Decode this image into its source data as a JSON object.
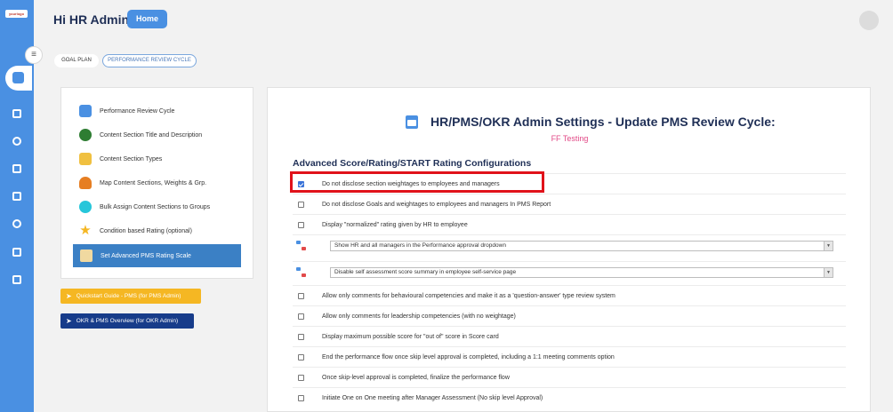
{
  "rail": {
    "logo_text": "yourlogo"
  },
  "header": {
    "greeting": "Hi HR Admin",
    "home_label": "Home"
  },
  "tabs": [
    {
      "label": "GOAL PLAN"
    },
    {
      "label": "PERFORMANCE REVIEW CYCLE"
    }
  ],
  "menu": {
    "items": [
      {
        "label": "Performance Review Cycle",
        "icon": "calendar-icon",
        "color": "#4a90e2"
      },
      {
        "label": "Content Section Title and Description",
        "icon": "dots-icon",
        "color": "#2e7d32"
      },
      {
        "label": "Content Section Types",
        "icon": "badge-icon",
        "color": "#f0c040"
      },
      {
        "label": "Map Content Sections, Weights & Grp.",
        "icon": "person-icon",
        "color": "#e67e22"
      },
      {
        "label": "Bulk Assign Content Sections to Groups",
        "icon": "group-icon",
        "color": "#26c6da"
      },
      {
        "label": "Condition based Rating (optional)",
        "icon": "star-icon",
        "color": "#f5b723"
      }
    ],
    "active_label": "Set Advanced PMS Rating Scale"
  },
  "quick_buttons": {
    "quickstart": "Quickstart Guide - PMS (for PMS Admin)",
    "overview": "OKR & PMS Overview (for OKR Admin)"
  },
  "main": {
    "title": "HR/PMS/OKR Admin Settings - Update PMS Review Cycle:",
    "subtitle": "FF Testing",
    "section_heading": "Advanced Score/Rating/START Rating Configurations",
    "options": [
      {
        "label": "Do not disclose section weightages to employees and managers",
        "checked": true
      },
      {
        "label": "Do not disclose Goals and weightages to employees and managers In PMS Report",
        "checked": false
      },
      {
        "label": "Display \"normalized\" rating given by HR to employee",
        "checked": false
      }
    ],
    "selects": [
      {
        "value": "Show HR and all managers in the Performance approval dropdown"
      },
      {
        "value": "Disable self assessment score summary in employee self-service page"
      }
    ],
    "options2": [
      {
        "label": "Allow only comments for behavioural competencies and make it as a 'question-answer' type review system",
        "checked": false
      },
      {
        "label": "Allow only comments for leadership competencies (with no weightage)",
        "checked": false
      },
      {
        "label": "Display maximum possible score for \"out of\" score in Score card",
        "checked": false
      },
      {
        "label": "End the performance flow once skip level approval is completed, including a 1:1 meeting comments option",
        "checked": false
      },
      {
        "label": "Once skip-level approval is completed, finalize the performance flow",
        "checked": false
      },
      {
        "label": "Initiate One on One meeting after Manager Assessment (No skip level Approval)",
        "checked": false
      }
    ]
  },
  "colors": {
    "accent": "#4a90e2",
    "highlight": "#e0121a",
    "title": "#1f2f56",
    "subtitle": "#e24a87"
  }
}
